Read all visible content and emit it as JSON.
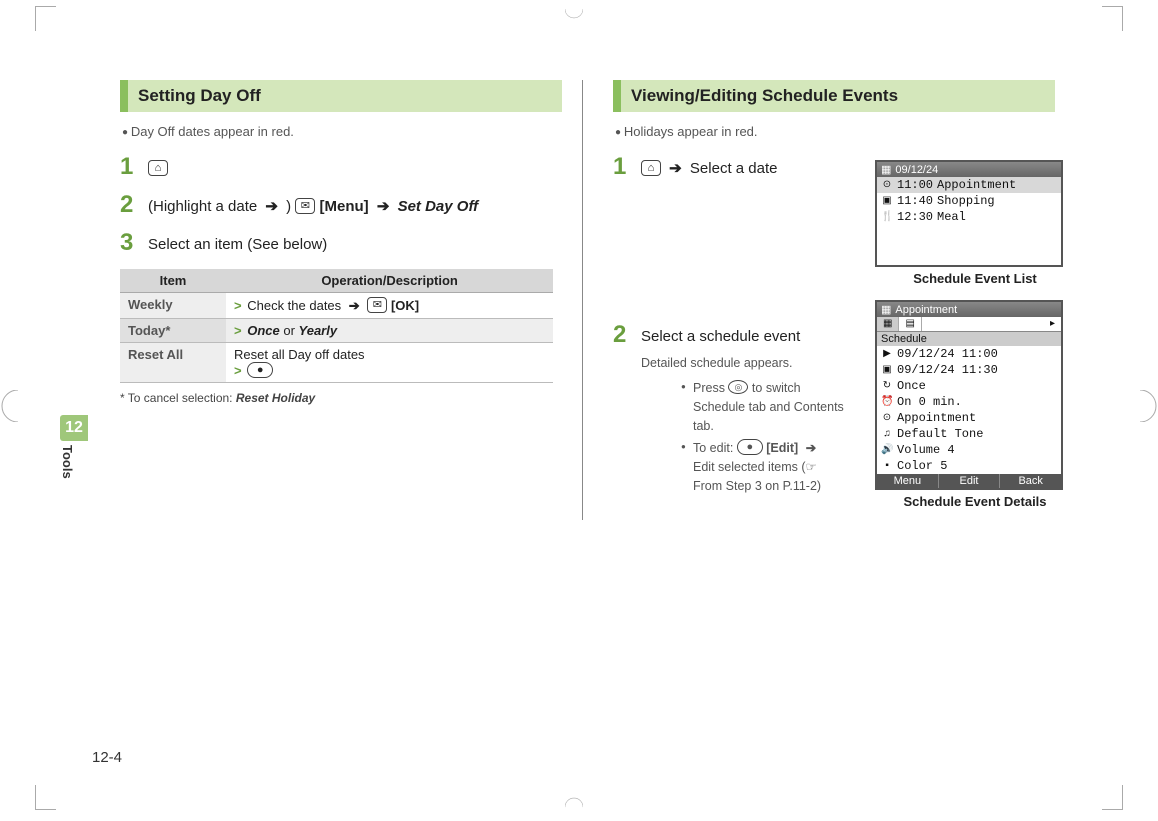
{
  "sideTab": {
    "number": "12",
    "label": "Tools"
  },
  "pageNumber": "12-4",
  "left": {
    "heading": "Setting Day Off",
    "intro": "Day Off dates appear in red.",
    "step1_key": "⌂",
    "step2_prefix": "(Highlight a date ",
    "step2_arrow": "➔",
    "step2_paren": " ) ",
    "step2_menuKey": "✉",
    "step2_menuLabel": "[Menu]",
    "step2_target": "Set Day Off",
    "step3": "Select an item (See below)",
    "table": {
      "head_item": "Item",
      "head_op": "Operation/Description",
      "rows": [
        {
          "item": "Weekly",
          "op_prefix": "Check the dates ",
          "op_arrow": "➔",
          "op_key": "✉",
          "op_keylabel": "[OK]"
        },
        {
          "item": "Today*",
          "op_once": "Once",
          "op_or": " or ",
          "op_yearly": "Yearly"
        },
        {
          "item": "Reset All",
          "op_text": "Reset all Day off dates",
          "op_key": "●"
        }
      ]
    },
    "footnote_prefix": "* To cancel selection: ",
    "footnote_bold": "Reset Holiday"
  },
  "right": {
    "heading": "Viewing/Editing Schedule Events",
    "intro": "Holidays appear in red.",
    "step1_key": "⌂",
    "step1_arrow": "➔",
    "step1_text": " Select a date",
    "step2_title": "Select a schedule event",
    "step2_sub1": "Detailed schedule appears.",
    "step2_b1a": "Press ",
    "step2_b1key": "◎",
    "step2_b1b": " to switch Schedule tab and Contents tab.",
    "step2_b2a": "To edit: ",
    "step2_b2key": "●",
    "step2_b2label": "[Edit]",
    "step2_b2arrow": "➔",
    "step2_b2c": " Edit selected items (☞From Step 3 on P.11-2)",
    "phone1": {
      "title": "09/12/24",
      "rows": [
        {
          "ico": "⊙",
          "time": "11:00",
          "text": "Appointment",
          "sel": true
        },
        {
          "ico": "▣",
          "time": "11:40",
          "text": "Shopping",
          "sel": false
        },
        {
          "ico": "🍴",
          "time": "12:30",
          "text": "Meal",
          "sel": false
        }
      ],
      "caption": "Schedule Event List"
    },
    "phone2": {
      "title": "Appointment",
      "tab1": "▦",
      "tab2": "▤",
      "tabArrow": "▸",
      "subhead": "Schedule",
      "rows": [
        {
          "ico": "▶",
          "text": "09/12/24 11:00"
        },
        {
          "ico": "▣",
          "text": "09/12/24 11:30"
        },
        {
          "ico": "↻",
          "text": "Once"
        },
        {
          "ico": "⏰",
          "text": "On 0 min."
        },
        {
          "ico": "⊙",
          "text": "Appointment"
        },
        {
          "ico": "♫",
          "text": "Default Tone"
        },
        {
          "ico": "🔊",
          "text": "Volume 4"
        },
        {
          "ico": "▪",
          "text": "Color 5"
        }
      ],
      "soft1": "Menu",
      "soft2": "Edit",
      "soft3": "Back",
      "caption": "Schedule Event Details"
    }
  }
}
